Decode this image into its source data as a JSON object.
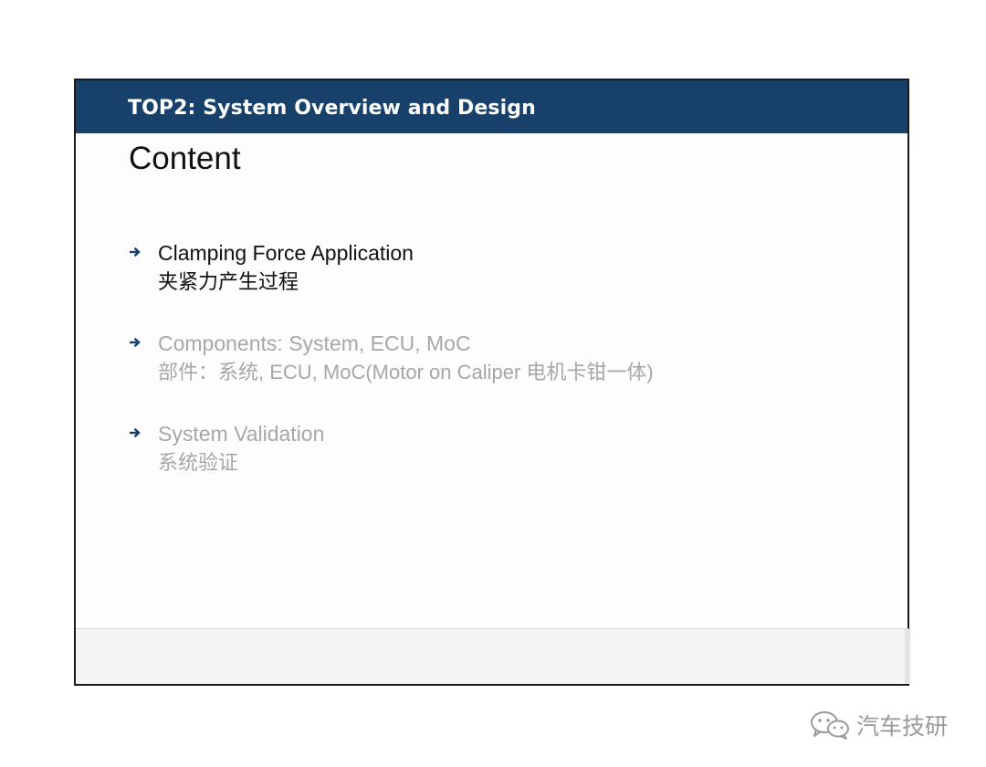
{
  "header": {
    "title": "TOP2: System Overview and Design"
  },
  "content_title": "Content",
  "agenda": [
    {
      "line1": "Clamping Force Application",
      "line2": "夹紧力产生过程",
      "state": "active"
    },
    {
      "line1": "Components: System, ECU, MoC",
      "line2": "部件：系统, ECU, MoC(Motor on Caliper 电机卡钳一体)",
      "state": "dim"
    },
    {
      "line1": "System Validation",
      "line2": "系统验证",
      "state": "dim"
    }
  ],
  "watermark": {
    "text": "汽车技研",
    "icon": "wechat-icon"
  },
  "colors": {
    "header_bg": "#17406a",
    "active_text": "#111111",
    "dim_text": "#a7a7ab",
    "arrow": "#17406a"
  }
}
